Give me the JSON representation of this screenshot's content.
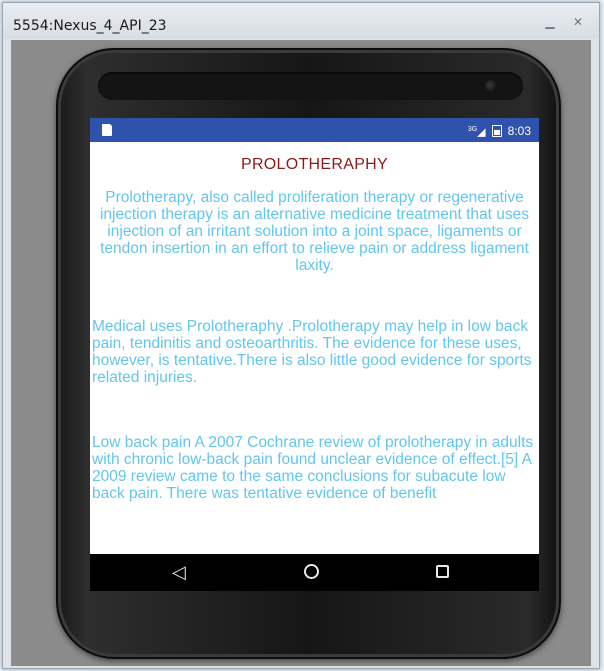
{
  "window": {
    "title": "5554:Nexus_4_API_23"
  },
  "status_bar": {
    "network": "3G",
    "time": "8:03"
  },
  "app": {
    "title": "PROLOTHERAPHY",
    "paragraphs": [
      "Prolotherapy, also called proliferation therapy or regenerative injection therapy is an alternative medicine treatment that uses injection of an irritant solution into a joint space, ligaments or tendon insertion in an effort to relieve pain or address ligament laxity.",
      "Medical uses Prolotheraphy .Prolotherapy may help in low back pain, tendinitis and osteoarthritis. The evidence for these uses, however, is tentative.There is also little good evidence for sports related injuries.",
      "Low back pain A 2007 Cochrane review of prolotherapy in adults with chronic low-back pain found unclear evidence of effect.[5] A 2009 review came to the same conclusions for subacute low back pain. There was tentative evidence of benefit"
    ]
  },
  "nav_bar": {
    "back_glyph": "◁"
  },
  "colors": {
    "status_bar": "#2f52ad",
    "title_text": "#8b1a1a",
    "body_text": "#63c6ee"
  },
  "icons": [
    "sd-card-icon",
    "signal-icon",
    "battery-icon",
    "back-icon",
    "home-icon",
    "recents-icon"
  ]
}
